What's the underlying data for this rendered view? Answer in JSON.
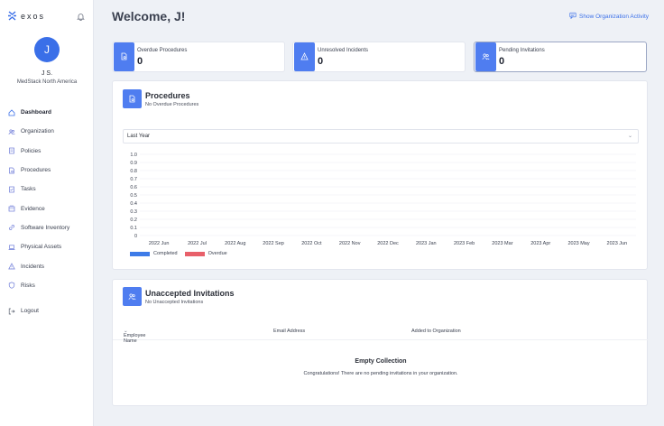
{
  "brand": {
    "name": "exos",
    "logo_icon": "exos-logo-icon"
  },
  "user": {
    "initial": "J",
    "name": "J S.",
    "org": "MedStack North America"
  },
  "nav": [
    {
      "label": "Dashboard",
      "icon": "home-icon",
      "active": true
    },
    {
      "label": "Organization",
      "icon": "people-icon"
    },
    {
      "label": "Policies",
      "icon": "policy-icon"
    },
    {
      "label": "Procedures",
      "icon": "procedure-icon"
    },
    {
      "label": "Tasks",
      "icon": "tasks-icon"
    },
    {
      "label": "Evidence",
      "icon": "evidence-icon"
    },
    {
      "label": "Software Inventory",
      "icon": "link-icon"
    },
    {
      "label": "Physical Assets",
      "icon": "laptop-icon"
    },
    {
      "label": "Incidents",
      "icon": "warning-icon"
    },
    {
      "label": "Risks",
      "icon": "shield-icon"
    }
  ],
  "logout": {
    "label": "Logout"
  },
  "header": {
    "welcome": "Welcome, J!",
    "activity_link": "Show Organization Activity"
  },
  "stats": [
    {
      "label": "Overdue Procedures",
      "value": "0"
    },
    {
      "label": "Unresolved Incidents",
      "value": "0"
    },
    {
      "label": "Pending Invitations",
      "value": "0"
    }
  ],
  "procedures": {
    "title": "Procedures",
    "subtitle": "No Overdue Procedures",
    "range_select": "Last Year"
  },
  "chart_data": {
    "type": "bar",
    "categories": [
      "2022 Jun",
      "2022 Jul",
      "2022 Aug",
      "2022 Sep",
      "2022 Oct",
      "2022 Nov",
      "2022 Dec",
      "2023 Jan",
      "2023 Feb",
      "2023 Mar",
      "2023 Apr",
      "2023 May",
      "2023 Jun"
    ],
    "series": [
      {
        "name": "Completed",
        "values": [
          0,
          0,
          0,
          0,
          0,
          0,
          0,
          0,
          0,
          0,
          0,
          0,
          0
        ],
        "color": "#3d7be8"
      },
      {
        "name": "Overdue",
        "values": [
          0,
          0,
          0,
          0,
          0,
          0,
          0,
          0,
          0,
          0,
          0,
          0,
          0
        ],
        "color": "#e8606a"
      }
    ],
    "yticks": [
      "0",
      "0.1",
      "0.2",
      "0.3",
      "0.4",
      "0.5",
      "0.6",
      "0.7",
      "0.8",
      "0.9",
      "1.0"
    ],
    "ylim": [
      0,
      1
    ],
    "grid": true,
    "legend": "bottom-left"
  },
  "invitations": {
    "title": "Unaccepted Invitations",
    "subtitle": "No Unaccepted Invitations",
    "columns": [
      "Employee Name",
      "Email Address",
      "Added to Organization"
    ],
    "sort_indicator": "⌄",
    "empty_title": "Empty Collection",
    "empty_message": "Congratulations! There are no pending invitations in your organization."
  },
  "colors": {
    "accent": "#3a6fe8",
    "completed": "#3d7be8",
    "overdue": "#e8606a"
  }
}
